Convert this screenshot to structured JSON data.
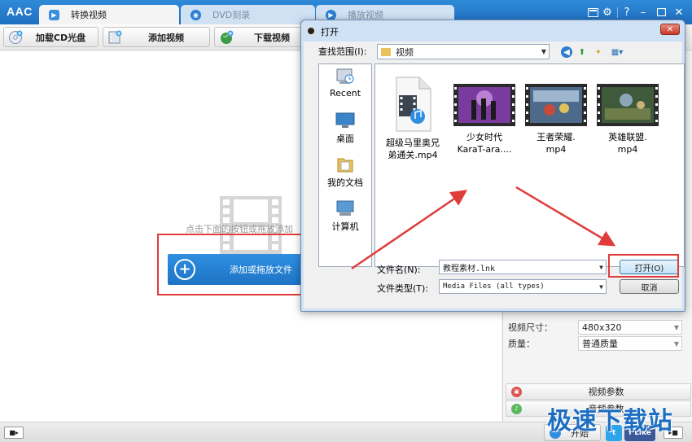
{
  "app": {
    "logo": "AAC",
    "tabs": [
      {
        "label": "转换视频",
        "icon": "convert-video-icon"
      },
      {
        "label": "DVD刻录",
        "icon": "dvd-burn-icon"
      },
      {
        "label": "播放视频",
        "icon": "play-video-icon"
      }
    ]
  },
  "toolbar": {
    "buttons": [
      {
        "label": "加载CD光盘",
        "icon": "load-cd-icon"
      },
      {
        "label": "添加视频",
        "icon": "add-video-icon"
      },
      {
        "label": "下载视频",
        "icon": "download-video-icon"
      }
    ]
  },
  "main": {
    "hint": "点击下面的按钮或拖放添加",
    "add_button_label": "添加或拖放文件"
  },
  "right_panel": {
    "rows": [
      {
        "label": "视频尺寸：",
        "value": "480x320"
      },
      {
        "label": "质量：",
        "value": "普通质量"
      }
    ],
    "video_params_label": "视频参数",
    "audio_params_label": "音频参数"
  },
  "statusbar": {
    "start_label": "开始",
    "facebook_label": "f Like"
  },
  "watermark": "极速下载站",
  "dialog": {
    "title": "打开",
    "close_label": "✕",
    "look_in_label": "查找范围(I):",
    "look_in_value": "视频",
    "places": [
      {
        "label": "Recent",
        "icon": "recent-places-icon"
      },
      {
        "label": "桌面",
        "icon": "desktop-icon"
      },
      {
        "label": "我的文档",
        "icon": "my-documents-icon"
      },
      {
        "label": "计算机",
        "icon": "computer-icon"
      }
    ],
    "files": [
      {
        "name": "超级马里奥兄弟通关.mp4",
        "line1": "超级马里奥兄",
        "line2": "弟通关.mp4"
      },
      {
        "name": "少女时代 KaraT-ara....",
        "line1": "少女时代",
        "line2": "KaraT-ara...."
      },
      {
        "name": "王者荣耀.mp4",
        "line1": "王者荣耀.",
        "line2": "mp4"
      },
      {
        "name": "英雄联盟.mp4",
        "line1": "英雄联盟.",
        "line2": "mp4"
      }
    ],
    "filename_label": "文件名(N):",
    "filename_value": "教程素材.lnk",
    "filetype_label": "文件类型(T):",
    "filetype_value": "Media Files (all types)",
    "open_label": "打开(O)",
    "cancel_label": "取消"
  },
  "colors": {
    "accent": "#1f6fc0",
    "highlight_red": "#e03c3c"
  }
}
